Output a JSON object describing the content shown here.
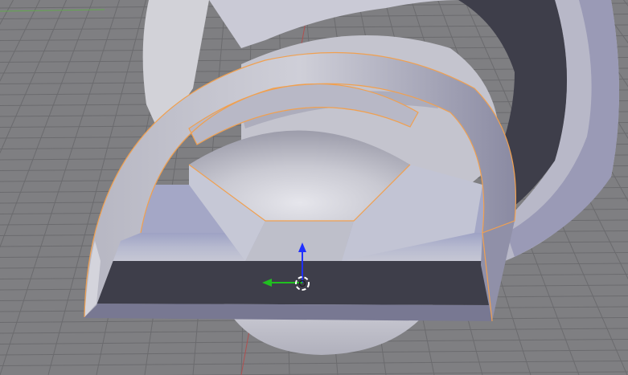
{
  "viewport": {
    "view": "3d-viewport",
    "colors": {
      "background": "#7f7f82",
      "grid_line": "#6b6b6e",
      "x_axis": "#b05050",
      "y_axis": "#63a84f",
      "mesh_light": "#dcdce2",
      "mesh_mid": "#a9a9b8",
      "mesh_dark": "#3e3e4a",
      "selection_outline": "#f0a050",
      "gizmo_z": "#2030ff",
      "gizmo_y": "#20c020"
    },
    "objects": [
      {
        "name": "outer-ring-mesh",
        "selected": false
      },
      {
        "name": "cone-mesh",
        "selected": false
      },
      {
        "name": "arch-bracket-mesh",
        "selected": true
      }
    ],
    "gizmo": {
      "icons": [
        "z-axis-arrow-icon",
        "y-axis-arrow-icon",
        "3d-cursor-icon"
      ]
    }
  }
}
